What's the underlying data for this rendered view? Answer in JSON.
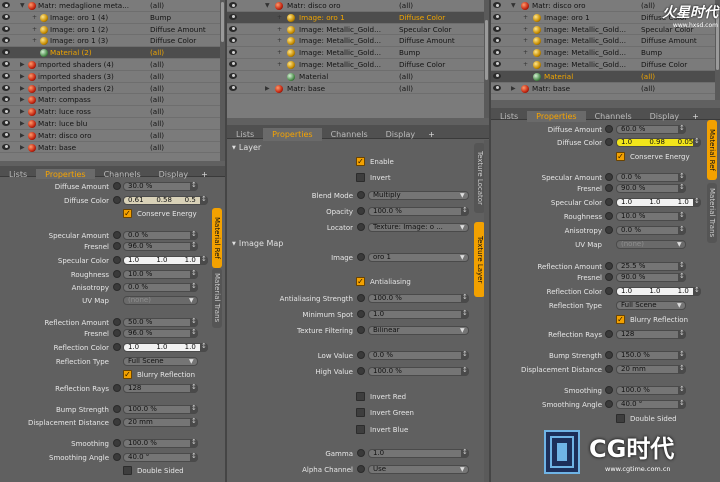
{
  "left": {
    "tree": [
      {
        "name": "Matr: medaglione meta...",
        "effect": "(all)",
        "kind": "mat",
        "indent": 1,
        "toggle": "▼"
      },
      {
        "name": "Image: oro 1 (4)",
        "effect": "Bump",
        "kind": "img",
        "indent": 2,
        "toggle": "+"
      },
      {
        "name": "Image: oro 1 (2)",
        "effect": "Diffuse Amount",
        "kind": "img",
        "indent": 2,
        "toggle": "+"
      },
      {
        "name": "Image: oro 1 (3)",
        "effect": "Diffuse Color",
        "kind": "img",
        "indent": 2,
        "toggle": "+"
      },
      {
        "name": "Material (2)",
        "effect": "(all)",
        "kind": "grn",
        "indent": 2,
        "toggle": "",
        "selected": true
      },
      {
        "name": "imported shaders (4)",
        "effect": "(all)",
        "kind": "mat",
        "indent": 1,
        "toggle": "▶"
      },
      {
        "name": "imported shaders (3)",
        "effect": "(all)",
        "kind": "mat",
        "indent": 1,
        "toggle": "▶"
      },
      {
        "name": "imported shaders (2)",
        "effect": "(all)",
        "kind": "mat",
        "indent": 1,
        "toggle": "▶"
      },
      {
        "name": "Matr: compass",
        "effect": "(all)",
        "kind": "mat",
        "indent": 1,
        "toggle": "▶"
      },
      {
        "name": "Matr: luce ross",
        "effect": "(all)",
        "kind": "mat",
        "indent": 1,
        "toggle": "▶"
      },
      {
        "name": "Matr: luce blu",
        "effect": "(all)",
        "kind": "mat",
        "indent": 1,
        "toggle": "▶"
      },
      {
        "name": "Matr: disco oro",
        "effect": "(all)",
        "kind": "mat",
        "indent": 1,
        "toggle": "▶"
      },
      {
        "name": "Matr: base",
        "effect": "(all)",
        "kind": "mat",
        "indent": 1,
        "toggle": "▶"
      }
    ],
    "tabs": [
      "Lists",
      "Properties",
      "Channels",
      "Display",
      "+"
    ],
    "vtabs": [
      "Material Ref",
      "Material Trans"
    ],
    "props": {
      "diffuse_amount_label": "Diffuse Amount",
      "diffuse_amount": "30.0 %",
      "diffuse_color_label": "Diffuse Color",
      "diffuse_color": [
        "0.61",
        "0.58",
        "0.5"
      ],
      "conserve_energy": "Conserve Energy",
      "specular_amount_label": "Specular Amount",
      "specular_amount": "0.0 %",
      "fresnel_label": "Fresnel",
      "fresnel": "96.0 %",
      "specular_color_label": "Specular Color",
      "specular_color": [
        "1.0",
        "1.0",
        "1.0"
      ],
      "roughness_label": "Roughness",
      "roughness": "10.0 %",
      "anisotropy_label": "Anisotropy",
      "anisotropy": "0.0 %",
      "uv_map_label": "UV Map",
      "uv_map": "(none)",
      "reflection_amount_label": "Reflection Amount",
      "reflection_amount": "50.0 %",
      "refl_fresnel_label": "Fresnel",
      "refl_fresnel": "96.0 %",
      "reflection_color_label": "Reflection Color",
      "reflection_color": [
        "1.0",
        "1.0",
        "1.0"
      ],
      "reflection_type_label": "Reflection Type",
      "reflection_type": "Full Scene",
      "blurry_reflection": "Blurry Reflection",
      "reflection_rays_label": "Reflection Rays",
      "reflection_rays": "128",
      "bump_strength_label": "Bump Strength",
      "bump_strength": "100.0 %",
      "displacement_label": "Displacement Distance",
      "displacement": "20 mm",
      "smoothing_label": "Smoothing",
      "smoothing": "100.0 %",
      "smoothing_angle_label": "Smoothing Angle",
      "smoothing_angle": "40.0 °",
      "double_sided": "Double Sided"
    }
  },
  "middle": {
    "tree": [
      {
        "name": "Matr: disco oro",
        "effect": "(all)",
        "kind": "mat",
        "indent": 1,
        "toggle": "▼"
      },
      {
        "name": "Image: oro 1",
        "effect": "Diffuse Color",
        "kind": "img",
        "indent": 2,
        "toggle": "+",
        "selected": true
      },
      {
        "name": "Image: Metallic_Gold...",
        "effect": "Specular Color",
        "kind": "img",
        "indent": 2,
        "toggle": "+"
      },
      {
        "name": "Image: Metallic_Gold...",
        "effect": "Diffuse Amount",
        "kind": "img",
        "indent": 2,
        "toggle": "+"
      },
      {
        "name": "Image: Metallic_Gold...",
        "effect": "Bump",
        "kind": "img",
        "indent": 2,
        "toggle": "+"
      },
      {
        "name": "Image: Metallic_Gold...",
        "effect": "Diffuse Color",
        "kind": "img",
        "indent": 2,
        "toggle": "+"
      },
      {
        "name": "Material",
        "effect": "(all)",
        "kind": "grn",
        "indent": 2,
        "toggle": ""
      },
      {
        "name": "Matr: base",
        "effect": "(all)",
        "kind": "mat",
        "indent": 1,
        "toggle": "▶"
      }
    ],
    "tabs": [
      "Lists",
      "Properties",
      "Channels",
      "Display",
      "+"
    ],
    "vtabs": [
      "Texture Locator",
      "Texture Layer"
    ],
    "layer_head": "Layer",
    "enable": "Enable",
    "invert": "Invert",
    "blend_mode_label": "Blend Mode",
    "blend_mode": "Multiply",
    "opacity_label": "Opacity",
    "opacity": "100.0 %",
    "locator_label": "Locator",
    "locator": "Texture: Image: o ...",
    "image_map_head": "Image Map",
    "image_label": "Image",
    "image": "oro 1",
    "antialiasing": "Antialiasing",
    "aa_strength_label": "Antialiasing Strength",
    "aa_strength": "100.0 %",
    "min_spot_label": "Minimum Spot",
    "min_spot": "1.0",
    "tex_filter_label": "Texture Filtering",
    "tex_filter": "Bilinear",
    "low_value_label": "Low Value",
    "low_value": "0.0 %",
    "high_value_label": "High Value",
    "high_value": "100.0 %",
    "invert_red": "Invert Red",
    "invert_green": "Invert Green",
    "invert_blue": "Invert Blue",
    "gamma_label": "Gamma",
    "gamma": "1.0",
    "alpha_label": "Alpha Channel",
    "alpha": "Use"
  },
  "right": {
    "tree": [
      {
        "name": "Matr: disco oro",
        "effect": "(all)",
        "kind": "mat",
        "indent": 1,
        "toggle": "▼"
      },
      {
        "name": "Image: oro 1",
        "effect": "Diffuse Color",
        "kind": "img",
        "indent": 2,
        "toggle": "+"
      },
      {
        "name": "Image: Metallic_Gold...",
        "effect": "Specular Color",
        "kind": "img",
        "indent": 2,
        "toggle": "+"
      },
      {
        "name": "Image: Metallic_Gold...",
        "effect": "Diffuse Amount",
        "kind": "img",
        "indent": 2,
        "toggle": "+"
      },
      {
        "name": "Image: Metallic_Gold...",
        "effect": "Bump",
        "kind": "img",
        "indent": 2,
        "toggle": "+"
      },
      {
        "name": "Image: Metallic_Gold...",
        "effect": "Diffuse Color",
        "kind": "img",
        "indent": 2,
        "toggle": "+"
      },
      {
        "name": "Material",
        "effect": "(all)",
        "kind": "grn",
        "indent": 2,
        "toggle": "",
        "selected": true
      },
      {
        "name": "Matr: base",
        "effect": "(all)",
        "kind": "mat",
        "indent": 1,
        "toggle": "▶"
      }
    ],
    "tabs": [
      "Lists",
      "Properties",
      "Channels",
      "Display",
      "+"
    ],
    "vtabs": [
      "Material Ref",
      "Material Trans"
    ],
    "props": {
      "diffuse_amount_label": "Diffuse Amount",
      "diffuse_amount": "60.0 %",
      "diffuse_color_label": "Diffuse Color",
      "diffuse_color": [
        "1.0",
        "0.98",
        "0.05"
      ],
      "conserve_energy": "Conserve Energy",
      "specular_amount_label": "Specular Amount",
      "specular_amount": "0.0 %",
      "fresnel_label": "Fresnel",
      "fresnel": "90.0 %",
      "specular_color_label": "Specular Color",
      "specular_color": [
        "1.0",
        "1.0",
        "1.0"
      ],
      "roughness_label": "Roughness",
      "roughness": "10.0 %",
      "anisotropy_label": "Anisotropy",
      "anisotropy": "0.0 %",
      "uv_map_label": "UV Map",
      "uv_map": "(none)",
      "reflection_amount_label": "Reflection Amount",
      "reflection_amount": "25.5 %",
      "refl_fresnel_label": "Fresnel",
      "refl_fresnel": "90.0 %",
      "reflection_color_label": "Reflection Color",
      "reflection_color": [
        "1.0",
        "1.0",
        "1.0"
      ],
      "reflection_type_label": "Reflection Type",
      "reflection_type": "Full Scene",
      "blurry_reflection": "Blurry Reflection",
      "reflection_rays_label": "Reflection Rays",
      "reflection_rays": "128",
      "bump_strength_label": "Bump Strength",
      "bump_strength": "150.0 %",
      "displacement_label": "Displacement Distance",
      "displacement": "20 mm",
      "smoothing_label": "Smoothing",
      "smoothing": "100.0 %",
      "smoothing_angle_label": "Smoothing Angle",
      "smoothing_angle": "40.0 °",
      "double_sided": "Double Sided"
    }
  },
  "watermark": {
    "logo": "CG时代",
    "site": "www.cgtime.com.cn",
    "top_logo": "火星时代",
    "top_site": "www.hxsd.com"
  },
  "colors": {
    "accent": "#f3a100",
    "yellow_field": "#f2e51a"
  }
}
